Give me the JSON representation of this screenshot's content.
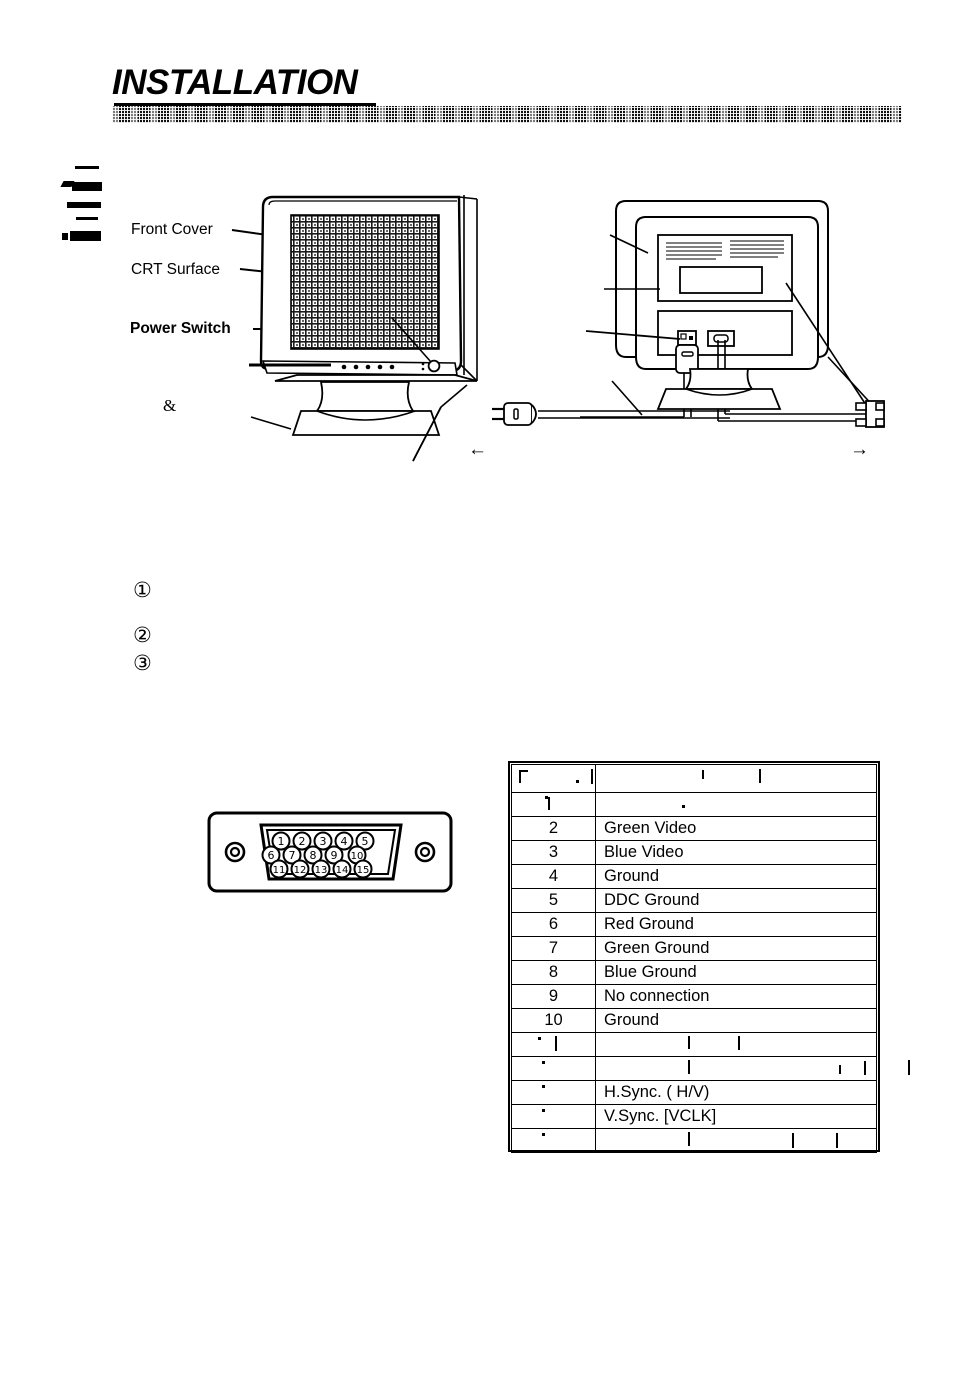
{
  "document": {
    "title": "INSTALLATION",
    "ampersand": "&"
  },
  "front_view": {
    "callouts": [
      {
        "label": "Front Cover",
        "bold": false
      },
      {
        "label": "CRT Surface",
        "bold": false
      },
      {
        "label": "Power Switch",
        "bold": true
      }
    ]
  },
  "steps": [
    {
      "marker": "①"
    },
    {
      "marker": "②"
    },
    {
      "marker": "③"
    }
  ],
  "cable_arrows": {
    "power_cable_arrow": "←",
    "signal_cable_arrow": "→"
  },
  "connector": {
    "pin_rows": [
      [
        "1",
        "2",
        "3",
        "4",
        "5"
      ],
      [
        "6",
        "7",
        "8",
        "9",
        "10"
      ],
      [
        "11",
        "12",
        "13",
        "14",
        "15"
      ]
    ]
  },
  "pin_table": {
    "header": {
      "pin": "",
      "signal": "",
      "legible": false
    },
    "rows": [
      {
        "pin": "",
        "signal": "",
        "legible": false
      },
      {
        "pin": "2",
        "signal": "Green Video",
        "legible": true
      },
      {
        "pin": "3",
        "signal": "Blue Video",
        "legible": true
      },
      {
        "pin": "4",
        "signal": "Ground",
        "legible": true
      },
      {
        "pin": "5",
        "signal": "DDC Ground",
        "legible": true
      },
      {
        "pin": "6",
        "signal": "Red Ground",
        "legible": true
      },
      {
        "pin": "7",
        "signal": "Green Ground",
        "legible": true
      },
      {
        "pin": "8",
        "signal": "Blue Ground",
        "legible": true
      },
      {
        "pin": "9",
        "signal": "No connection",
        "legible": true
      },
      {
        "pin": "10",
        "signal": "Ground",
        "legible": true
      },
      {
        "pin": "",
        "signal": "",
        "legible": false
      },
      {
        "pin": "",
        "signal": "",
        "legible": false
      },
      {
        "pin": "",
        "signal": "H.Sync. (   H/V)",
        "legible": true
      },
      {
        "pin": "",
        "signal": "V.Sync.   [VCLK]",
        "legible": true
      },
      {
        "pin": "",
        "signal": "",
        "legible": false
      }
    ]
  },
  "colors": {
    "ink": "#000000",
    "paper": "#ffffff"
  }
}
